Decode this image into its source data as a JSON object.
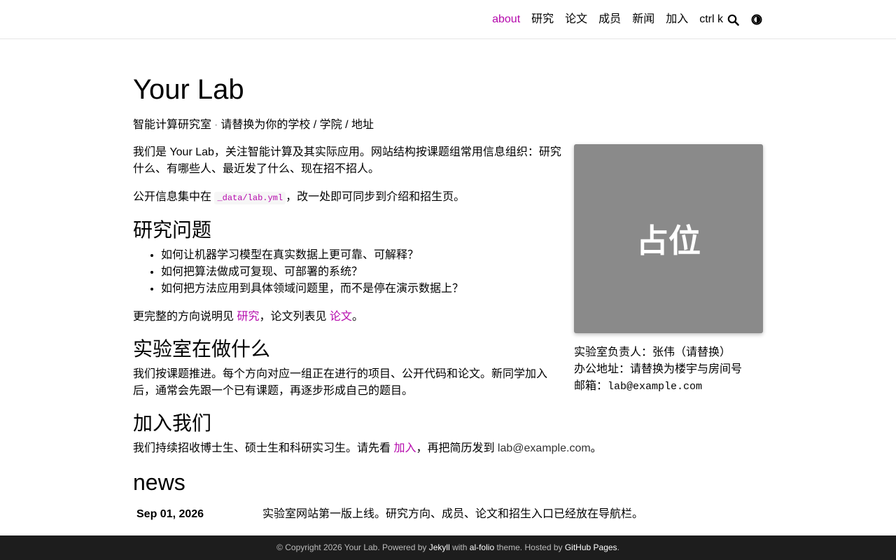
{
  "nav": {
    "items": [
      {
        "label": "about",
        "active": true
      },
      {
        "label": "研究",
        "active": false
      },
      {
        "label": "论文",
        "active": false
      },
      {
        "label": "成员",
        "active": false
      },
      {
        "label": "新闻",
        "active": false
      },
      {
        "label": "加入",
        "active": false
      }
    ],
    "search_shortcut": "ctrl k",
    "search_icon": "search-icon",
    "theme_icon": "theme-toggle-icon"
  },
  "colors": {
    "accent": "#B509AC",
    "placeholder": "#8a8a8a",
    "footer_bg": "#1d1d1d"
  },
  "page": {
    "title": "Your Lab",
    "subtitle_part1": "智能计算研究室",
    "subtitle_sep": "·",
    "subtitle_part2": "请替换为你的学校 / 学院 / 地址"
  },
  "intro": {
    "p1": "我们是 Your Lab，关注智能计算及其实际应用。网站结构按课题组常用信息组织：研究什么、有哪些人、最近发了什么、现在招不招人。",
    "p2_before": "公开信息集中在 ",
    "p2_code": "_data/lab.yml",
    "p2_after": "，改一处即可同步到介绍和招生页。"
  },
  "research": {
    "heading": "研究问题",
    "items": [
      "如何让机器学习模型在真实数据上更可靠、可解释？",
      "如何把算法做成可复现、可部署的系统？",
      "如何把方法应用到具体领域问题里，而不是停在演示数据上？"
    ],
    "more_before": "更完整的方向说明见 ",
    "more_link1": "研究",
    "more_middle": "，论文列表见 ",
    "more_link2": "论文",
    "more_after": "。"
  },
  "doing": {
    "heading": "实验室在做什么",
    "text": "我们按课题推进。每个方向对应一组正在进行的项目、公开代码和论文。新同学加入后，通常会先跟一个已有课题，再逐步形成自己的题目。"
  },
  "sidebar": {
    "placeholder_text": "占位",
    "pi": "实验室负责人：张伟（请替换）",
    "office": "办公地址：请替换为楼宇与房间号",
    "email_label": "邮箱：",
    "email": "lab@example.com"
  },
  "join": {
    "heading": "加入我们",
    "before": "我们持续招收博士生、硕士生和科研实习生。请先看 ",
    "link": "加入",
    "middle": "，再把简历发到 ",
    "email": "lab@example.com",
    "after": "。"
  },
  "news": {
    "heading": "news",
    "items": [
      {
        "date": "Sep 01, 2026",
        "text": "实验室网站第一版上线。研究方向、成员、论文和招生入口已经放在导航栏。"
      }
    ]
  },
  "footer": {
    "copyright": "© Copyright 2026 Your Lab. Powered by ",
    "jekyll": "Jekyll",
    "with": " with ",
    "alfolio": "al-folio",
    "theme": " theme. Hosted by ",
    "ghpages": "GitHub Pages",
    "end": "."
  }
}
